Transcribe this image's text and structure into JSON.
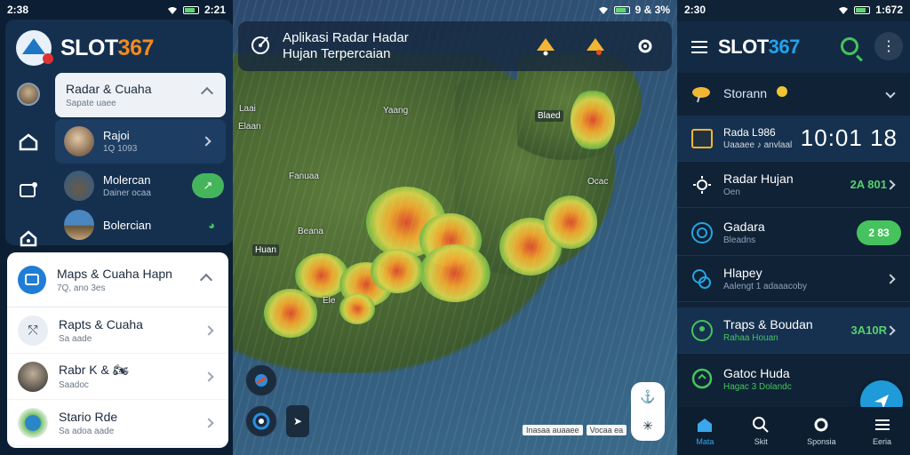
{
  "left": {
    "status": {
      "time": "2:38",
      "right": "2:21"
    },
    "brand_a": "SLOT",
    "brand_b": "367",
    "expanded": {
      "title": "Radar & Cuaha",
      "subtitle": "Sapate uaee"
    },
    "items": [
      {
        "title": "Rajoi",
        "subtitle": "1Q 1093"
      },
      {
        "title": "Molercan",
        "subtitle": "Dainer ocaa",
        "pill": "↗"
      },
      {
        "title": "Bolercian",
        "subtitle": ""
      }
    ],
    "panel": {
      "title": "Maps & Cuaha Hapn",
      "subtitle": "7Q, ano 3es",
      "items": [
        {
          "title": "Rapts & Cuaha",
          "subtitle": "Sa aade"
        },
        {
          "title": "Rabr K & 🏍",
          "subtitle": "Saadoc"
        },
        {
          "title": "Stario Rde",
          "subtitle": "Sa adoa aade"
        }
      ]
    }
  },
  "map": {
    "status": {
      "right": "9 & 3%"
    },
    "title_line1": "Aplikasi Radar Hadar",
    "title_line2": "Hujan Terpercaian",
    "labels": {
      "yang": "Yaang",
      "east": "Blaed",
      "lab1": "Laai",
      "lab2": "Fanuaa",
      "lab3": "Ocac",
      "huan": "Huan",
      "ele": "Ele",
      "ella": "Elaan",
      "ocean": "Beana"
    },
    "nav_btn": "➤",
    "scale": [
      "Inasaa auaaee",
      "Vocaa ea"
    ]
  },
  "right": {
    "status": {
      "time": "2:30",
      "right": "1:672"
    },
    "brand_a": "SLOT",
    "brand_b": "367",
    "more": "⋮",
    "rows": [
      {
        "title": "Storann",
        "subtitle": ""
      },
      {
        "title": "Rada  L986",
        "subtitle": "Uaaaee  ♪ anvlaal",
        "time": "10:01 18"
      },
      {
        "title": "Radar Hujan",
        "subtitle": "Oen",
        "value": "2A 801"
      },
      {
        "title": "Gadara",
        "subtitle": "Bleadns",
        "pill": "2 83"
      },
      {
        "title": "Hlapey",
        "subtitle": "Aalengt 1 adaaacoby"
      },
      {
        "title": "Traps & Boudan",
        "subtitle": "Rahaa Houan",
        "value": "3A10R"
      },
      {
        "title": "Gatoc Huda",
        "subtitle": "Hagac 3 Dolandc"
      }
    ],
    "nav": [
      {
        "label": "Mata"
      },
      {
        "label": "Skit"
      },
      {
        "label": "Sponsia"
      },
      {
        "label": "Eeria"
      }
    ]
  }
}
